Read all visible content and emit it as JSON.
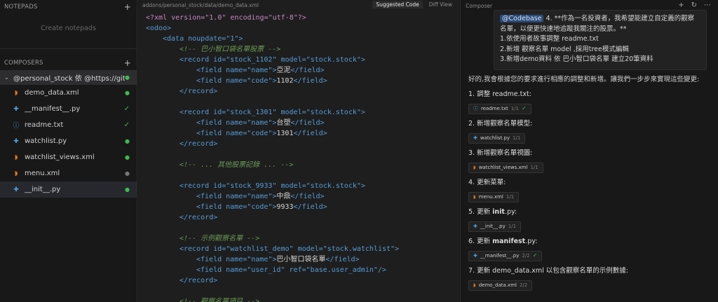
{
  "sidebar": {
    "notepads_header": "NOTEPADS",
    "notepads_empty": "Create notepads",
    "composers_header": "COMPOSERS",
    "composer_title": "@personal_stock 依 @https://git...",
    "files": [
      {
        "name": "demo_data.xml",
        "icon": "rss-icon",
        "status": "dot"
      },
      {
        "name": "__manifest__.py",
        "icon": "python-icon",
        "status": "check"
      },
      {
        "name": "readme.txt",
        "icon": "info-icon",
        "status": "check"
      },
      {
        "name": "watchlist.py",
        "icon": "python-icon",
        "status": "dot"
      },
      {
        "name": "watchlist_views.xml",
        "icon": "rss-icon",
        "status": "dot"
      },
      {
        "name": "menu.xml",
        "icon": "rss-icon",
        "status": "dot-gray"
      },
      {
        "name": "__init__.py",
        "icon": "python-icon",
        "status": "dot"
      }
    ]
  },
  "editor": {
    "path": "addons/personal_stock/data/demo_data.xml",
    "tab_suggested": "Suggested Code",
    "tab_diff": "Diff View",
    "lines": {
      "l1": "<?xml version=\"1.0\" encoding=\"utf-8\"?>",
      "l2_tag": "<odoo>",
      "l3": "<data noupdate=\"1\">",
      "c1": "<!-- 巴小智口袋名單股票 -->",
      "r1": "<record id=\"stock_1102\" model=\"stock.stock\">",
      "r1f1_name": "亞泥",
      "r1f2_code": "1102",
      "r2": "<record id=\"stock_1301\" model=\"stock.stock\">",
      "r2f1_name": "台塑",
      "r2f2_code": "1301",
      "c2": "<!-- ... 其他股票記錄 ... -->",
      "r3": "<record id=\"stock_9933\" model=\"stock.stock\">",
      "r3f1_name": "中鼎",
      "r3f2_code": "9933",
      "c3": "<!-- 示例觀察名單 -->",
      "r4": "<record id=\"watchlist_demo\" model=\"stock.watchlist\">",
      "r4f1_name": "巴小智口袋名單",
      "r4f2_ref": "base.user_admin",
      "c4": "<!-- 觀察名單項目 -->",
      "record_close": "</record>",
      "field_open_name": "<field name=\"name\">",
      "field_open_code": "<field name=\"code\">",
      "field_close": "</field>",
      "field_user": "<field name=\"user_id\" ref=\"base.user_admin\"/>"
    }
  },
  "composer": {
    "title": "Composer",
    "user_message": {
      "chip": "@Codebase",
      "text": " 4. **作為一名投資者，我希望能建立自定義的觀察名單，以便更快速地追蹤我關注的股票。**",
      "items": [
        "1.依使用者故事調整 readme.txt",
        "2.新增 觀察名單 model ,採用tree模式編輯",
        "3.新增demo資料 依 巴小智口袋名單 建立20筆資料"
      ]
    },
    "response_intro": "好的,我會根據您的要求進行相應的調整和新增。讓我們一步步來實現這些變更:",
    "steps": [
      {
        "title": "1. 調整 readme.txt:",
        "file": "readme.txt",
        "count": "1/1",
        "icon": "info-icon",
        "check": true
      },
      {
        "title": "2. 新增觀察名單模型:",
        "file": "watchlist.py",
        "count": "1/1",
        "icon": "python-icon",
        "check": false
      },
      {
        "title": "3. 新增觀察名單視圖:",
        "file": "watchlist_views.xml",
        "count": "1/1",
        "icon": "rss-icon",
        "check": false
      },
      {
        "title": "4. 更新菜單:",
        "file": "menu.xml",
        "count": "1/1",
        "icon": "rss-icon",
        "check": false
      },
      {
        "title_pre": "5. 更新 ",
        "title_bold": "init",
        "title_post": ".py:",
        "file": "__init__.py",
        "count": "1/1",
        "icon": "python-icon",
        "check": false
      },
      {
        "title_pre": "6. 更新 ",
        "title_bold": "manifest",
        "title_post": ".py:",
        "file": "__manifest__.py",
        "count": "2/2",
        "icon": "python-icon",
        "check": true
      },
      {
        "title": "7. 更新 demo_data.xml 以包含觀察名單的示例數據:",
        "file": "demo_data.xml",
        "count": "2/2",
        "icon": "rss-icon",
        "check": false
      }
    ]
  }
}
